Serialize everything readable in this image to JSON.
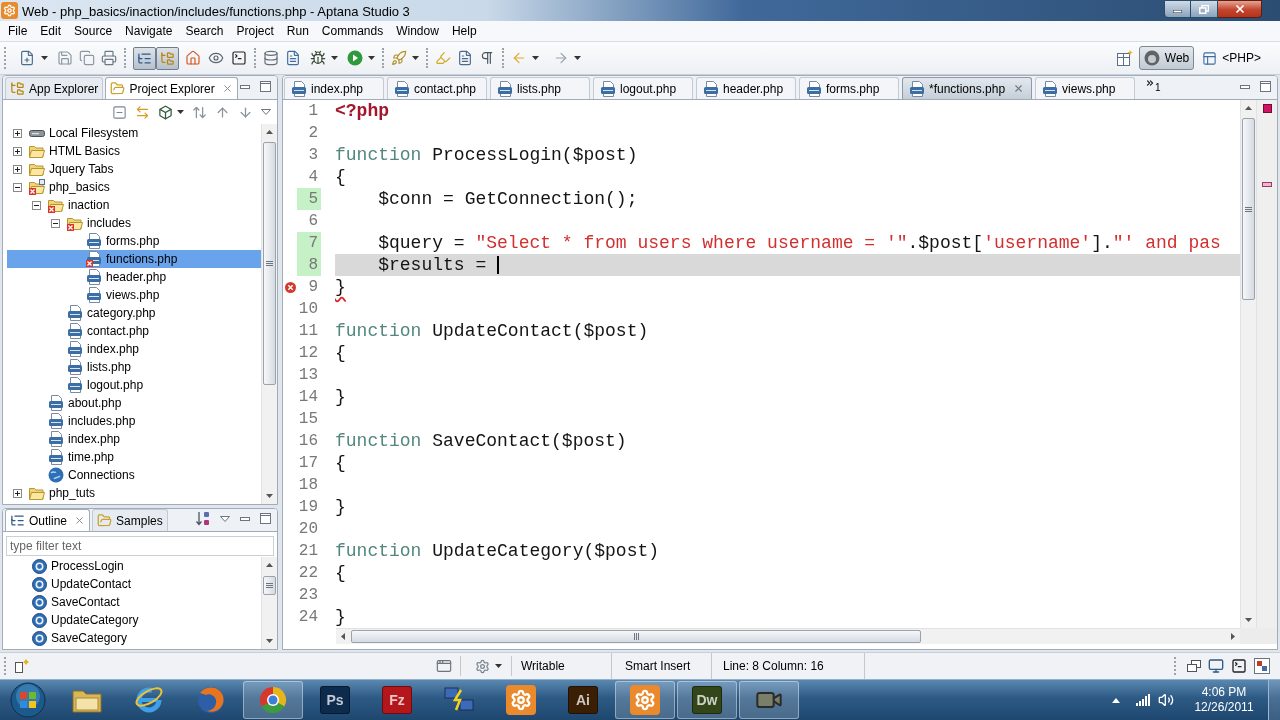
{
  "window": {
    "title": "Web - php_basics/inaction/includes/functions.php - Aptana Studio 3"
  },
  "menu": [
    "File",
    "Edit",
    "Source",
    "Navigate",
    "Search",
    "Project",
    "Run",
    "Commands",
    "Window",
    "Help"
  ],
  "toolbar": {
    "view_toggles": [
      {
        "pressed": true
      },
      {
        "pressed": true
      }
    ],
    "perspectives": [
      {
        "label": "Web",
        "selected": true
      },
      {
        "label": "<PHP>",
        "selected": false
      }
    ]
  },
  "project_explorer": {
    "tabs": [
      {
        "label": "App Explorer",
        "selected": false
      },
      {
        "label": "Project Explorer",
        "selected": true
      }
    ],
    "tree": [
      {
        "label": "Local Filesystem",
        "kind": "drive",
        "expanded": false,
        "selected": false,
        "error": false
      },
      {
        "label": "HTML Basics",
        "kind": "folder",
        "expanded": false,
        "selected": false,
        "error": false
      },
      {
        "label": "Jquery Tabs",
        "kind": "folder",
        "expanded": false,
        "selected": false,
        "error": false
      },
      {
        "label": "php_basics",
        "kind": "project",
        "expanded": true,
        "selected": false,
        "error": true,
        "children": [
          {
            "label": "inaction",
            "kind": "folder",
            "expanded": true,
            "selected": false,
            "error": true,
            "children": [
              {
                "label": "includes",
                "kind": "folder",
                "expanded": true,
                "selected": false,
                "error": true,
                "children": [
                  {
                    "label": "forms.php",
                    "kind": "php",
                    "selected": false,
                    "error": false
                  },
                  {
                    "label": "functions.php",
                    "kind": "php",
                    "selected": true,
                    "error": true
                  },
                  {
                    "label": "header.php",
                    "kind": "php",
                    "selected": false,
                    "error": false
                  },
                  {
                    "label": "views.php",
                    "kind": "php",
                    "selected": false,
                    "error": false
                  }
                ]
              },
              {
                "label": "category.php",
                "kind": "php",
                "selected": false,
                "error": false
              },
              {
                "label": "contact.php",
                "kind": "php",
                "selected": false,
                "error": false
              },
              {
                "label": "index.php",
                "kind": "php",
                "selected": false,
                "error": false
              },
              {
                "label": "lists.php",
                "kind": "php",
                "selected": false,
                "error": false
              },
              {
                "label": "logout.php",
                "kind": "php",
                "selected": false,
                "error": false
              }
            ]
          },
          {
            "label": "about.php",
            "kind": "php",
            "selected": false,
            "error": false
          },
          {
            "label": "includes.php",
            "kind": "php",
            "selected": false,
            "error": false
          },
          {
            "label": "index.php",
            "kind": "php",
            "selected": false,
            "error": false
          },
          {
            "label": "time.php",
            "kind": "php",
            "selected": false,
            "error": false
          },
          {
            "label": "Connections",
            "kind": "connections",
            "selected": false,
            "error": false
          }
        ]
      },
      {
        "label": "php_tuts",
        "kind": "folder",
        "expanded": false,
        "selected": false,
        "error": false
      }
    ]
  },
  "outline": {
    "tabs": [
      {
        "label": "Outline",
        "selected": true
      },
      {
        "label": "Samples",
        "selected": false
      }
    ],
    "filter": {
      "placeholder": "type filter text"
    },
    "items": [
      {
        "label": "ProcessLogin",
        "selected": false
      },
      {
        "label": "UpdateContact",
        "selected": false
      },
      {
        "label": "SaveContact",
        "selected": false
      },
      {
        "label": "UpdateCategory",
        "selected": false
      },
      {
        "label": "SaveCategory",
        "selected": false
      }
    ]
  },
  "editor": {
    "tabs": [
      {
        "label": "index.php",
        "selected": false
      },
      {
        "label": "contact.php",
        "selected": false
      },
      {
        "label": "lists.php",
        "selected": false
      },
      {
        "label": "logout.php",
        "selected": false
      },
      {
        "label": "header.php",
        "selected": false
      },
      {
        "label": "forms.php",
        "selected": false
      },
      {
        "label": "*functions.php",
        "selected": true
      },
      {
        "label": "views.php",
        "selected": false
      }
    ],
    "overflow_count": "1",
    "lines": [
      {
        "number": "1",
        "tokens": [
          {
            "kind": "tag",
            "text": "<?php"
          }
        ],
        "changed": false,
        "current": false,
        "error": false
      },
      {
        "number": "2",
        "changed": false,
        "current": false,
        "error": false
      },
      {
        "number": "3",
        "tokens": [
          {
            "kind": "keyword",
            "text": "function"
          },
          {
            "kind": "plain",
            "text": " ProcessLogin($post)"
          }
        ],
        "changed": false,
        "current": false,
        "error": false
      },
      {
        "number": "4",
        "tokens": [
          {
            "kind": "plain",
            "text": "{"
          }
        ],
        "changed": false,
        "current": false,
        "error": false
      },
      {
        "number": "5",
        "tokens": [
          {
            "kind": "plain",
            "text": "    $conn = GetConnection();"
          }
        ],
        "changed": true,
        "current": false,
        "error": false
      },
      {
        "number": "6",
        "changed": false,
        "current": false,
        "error": false
      },
      {
        "number": "7",
        "tokens": [
          {
            "kind": "plain",
            "text": "    $query = "
          },
          {
            "kind": "string",
            "text": "\"Select * from users where username = '\""
          },
          {
            "kind": "plain",
            "text": ".$post["
          },
          {
            "kind": "string",
            "text": "'username'"
          },
          {
            "kind": "plain",
            "text": "]."
          },
          {
            "kind": "string",
            "text": "\"' and pas"
          }
        ],
        "changed": true,
        "current": false,
        "error": false
      },
      {
        "number": "8",
        "tokens": [
          {
            "kind": "plain",
            "text": "    $results = "
          }
        ],
        "changed": true,
        "current": true,
        "error": false
      },
      {
        "number": "9",
        "tokens": [
          {
            "kind": "plain",
            "text": "}"
          }
        ],
        "changed": false,
        "current": false,
        "error": true
      },
      {
        "number": "10",
        "changed": false,
        "current": false,
        "error": false
      },
      {
        "number": "11",
        "tokens": [
          {
            "kind": "keyword",
            "text": "function"
          },
          {
            "kind": "plain",
            "text": " UpdateContact($post)"
          }
        ],
        "changed": false,
        "current": false,
        "error": false
      },
      {
        "number": "12",
        "tokens": [
          {
            "kind": "plain",
            "text": "{"
          }
        ],
        "changed": false,
        "current": false,
        "error": false
      },
      {
        "number": "13",
        "changed": false,
        "current": false,
        "error": false
      },
      {
        "number": "14",
        "tokens": [
          {
            "kind": "plain",
            "text": "}"
          }
        ],
        "changed": false,
        "current": false,
        "error": false
      },
      {
        "number": "15",
        "changed": false,
        "current": false,
        "error": false
      },
      {
        "number": "16",
        "tokens": [
          {
            "kind": "keyword",
            "text": "function"
          },
          {
            "kind": "plain",
            "text": " SaveContact($post)"
          }
        ],
        "changed": false,
        "current": false,
        "error": false
      },
      {
        "number": "17",
        "tokens": [
          {
            "kind": "plain",
            "text": "{"
          }
        ],
        "changed": false,
        "current": false,
        "error": false
      },
      {
        "number": "18",
        "changed": false,
        "current": false,
        "error": false
      },
      {
        "number": "19",
        "tokens": [
          {
            "kind": "plain",
            "text": "}"
          }
        ],
        "changed": false,
        "current": false,
        "error": false
      },
      {
        "number": "20",
        "changed": false,
        "current": false,
        "error": false
      },
      {
        "number": "21",
        "tokens": [
          {
            "kind": "keyword",
            "text": "function"
          },
          {
            "kind": "plain",
            "text": " UpdateCategory($post)"
          }
        ],
        "changed": false,
        "current": false,
        "error": false
      },
      {
        "number": "22",
        "tokens": [
          {
            "kind": "plain",
            "text": "{"
          }
        ],
        "changed": false,
        "current": false,
        "error": false
      },
      {
        "number": "23",
        "changed": false,
        "current": false,
        "error": false
      },
      {
        "number": "24",
        "tokens": [
          {
            "kind": "plain",
            "text": "}"
          }
        ],
        "changed": false,
        "current": false,
        "error": false
      }
    ]
  },
  "status_bar": {
    "items": [
      "Writable",
      "Smart Insert",
      "Line: 8 Column: 16"
    ]
  },
  "taskbar": {
    "apps": [
      {
        "kind": "folder",
        "running": false
      },
      {
        "kind": "letter",
        "running": false
      },
      {
        "kind": "globe",
        "running": false
      },
      {
        "kind": "ring",
        "running": true
      },
      {
        "kind": "tile",
        "label": "Ps",
        "color": "#0d2b4d",
        "running": false
      },
      {
        "kind": "tile",
        "label": "Fz",
        "color": "#b3161b",
        "running": false
      },
      {
        "kind": "network",
        "running": false
      },
      {
        "kind": "gear",
        "running": false
      },
      {
        "kind": "tile",
        "label": "Ai",
        "color": "#3b1f05",
        "running": false
      },
      {
        "kind": "gear",
        "running": true
      },
      {
        "kind": "tile",
        "label": "Dw",
        "color": "#33461a",
        "running": true
      },
      {
        "kind": "camera",
        "running": true
      }
    ],
    "clock": {
      "time": "4:06 PM",
      "date": "12/26/2011"
    }
  }
}
